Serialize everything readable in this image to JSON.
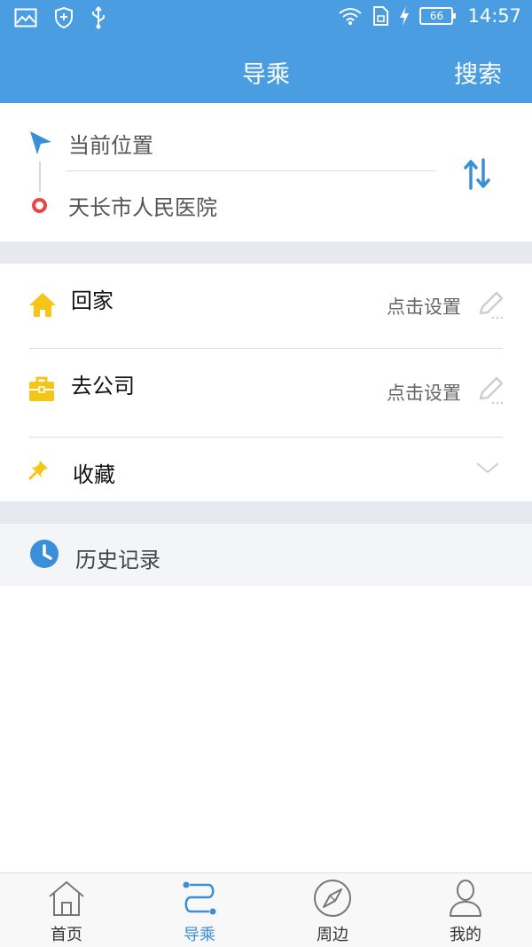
{
  "status_bar": {
    "battery": "66",
    "time": "14:57"
  },
  "nav": {
    "title": "导乘",
    "search_label": "搜索"
  },
  "route": {
    "from": "当前位置",
    "to": "天长市人民医院"
  },
  "places": {
    "home_label": "回家",
    "home_action": "点击设置",
    "work_label": "去公司",
    "work_action": "点击设置",
    "favorites_label": "收藏"
  },
  "history": {
    "label": "历史记录"
  },
  "tabs": [
    {
      "label": "首页",
      "icon": "home-icon"
    },
    {
      "label": "导乘",
      "icon": "route-icon"
    },
    {
      "label": "周边",
      "icon": "compass-icon"
    },
    {
      "label": "我的",
      "icon": "person-icon"
    }
  ],
  "colors": {
    "primary": "#4a9de0",
    "active_tab": "#3a8fd8",
    "home_icon": "#f5c518",
    "destination_dot": "#e64747"
  }
}
